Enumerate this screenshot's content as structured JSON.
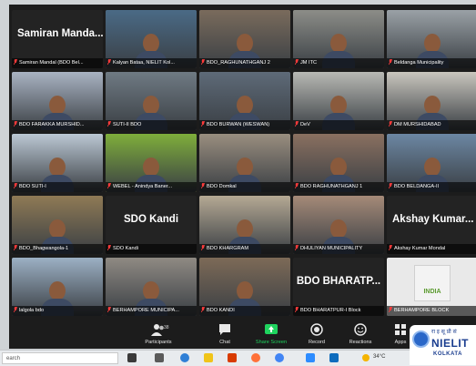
{
  "tiles": [
    {
      "big": "Samiran Manda...",
      "label": "Samiran Mandal (BDO Bel...",
      "scene": "dark",
      "active": false
    },
    {
      "big": "",
      "label": "Kalyan Bataa, NIELIT Kol...",
      "scene": "#4a6a86",
      "active": false
    },
    {
      "big": "",
      "label": "BDO_RAGHUNATHGANJ 2",
      "scene": "#7a6b5c",
      "active": false
    },
    {
      "big": "",
      "label": "JM ITC",
      "scene": "#8c8d88",
      "active": false
    },
    {
      "big": "",
      "label": "Beldanga Municipality",
      "scene": "#9aa1a6",
      "active": false
    },
    {
      "big": "",
      "label": "BDO FARAKKA MURSHID...",
      "scene": "#a9b3c2",
      "active": false
    },
    {
      "big": "",
      "label": "SUTI-II BDO",
      "scene": "#6f7a83",
      "active": false
    },
    {
      "big": "",
      "label": "BDO BURWAN (WESWAN)",
      "scene": "#5e6a78",
      "active": false
    },
    {
      "big": "",
      "label": "DeV",
      "scene": "#b8b9b4",
      "active": false
    },
    {
      "big": "",
      "label": "DM MURSHIDABAD",
      "scene": "#c9c6be",
      "active": false
    },
    {
      "big": "",
      "label": "BDO SUTI-I",
      "scene": "#bcc8d4",
      "active": false
    },
    {
      "big": "",
      "label": "WEBEL - Anindya Baner...",
      "scene": "#7fae3b",
      "active": true
    },
    {
      "big": "",
      "label": "BDO Domkal",
      "scene": "#9a8e7f",
      "active": false
    },
    {
      "big": "",
      "label": "BDO RAGHUNATHGANJ 1",
      "scene": "#8a7060",
      "active": false
    },
    {
      "big": "",
      "label": "BDO BELDANGA-II",
      "scene": "#6c87a3",
      "active": false
    },
    {
      "big": "",
      "label": "BDO_Bhagwangola-1",
      "scene": "#8f7a55",
      "active": false
    },
    {
      "big": "SDO Kandi",
      "label": "SDO Kandi",
      "scene": "dark",
      "active": false
    },
    {
      "big": "",
      "label": "BDO KHARGRAM",
      "scene": "#b5a994",
      "active": false
    },
    {
      "big": "",
      "label": "DHULIYAN MUNICIPALITY",
      "scene": "#a58a78",
      "active": false
    },
    {
      "big": "Akshay Kumar...",
      "label": "Akshay Kumar Mondal",
      "scene": "dark",
      "active": false
    },
    {
      "big": "",
      "label": "lalgola bdo",
      "scene": "#9cb0c4",
      "active": false
    },
    {
      "big": "",
      "label": "BERHAMPORE MUNICIPA...",
      "scene": "#8f8a83",
      "active": false
    },
    {
      "big": "",
      "label": "BDO KANDI",
      "scene": "#7d6a57",
      "active": false
    },
    {
      "big": "BDO BHARATP...",
      "label": "BDO BHARATPUR-I Block",
      "scene": "dark",
      "active": false
    },
    {
      "big": "",
      "label": "BERHAMPORE BLOCK",
      "scene": "logo",
      "logo_text": "INDIA",
      "active": false
    }
  ],
  "controls": {
    "participants": {
      "label": "Participants",
      "count": "38"
    },
    "chat": "Chat",
    "share": "Share Screen",
    "record": "Record",
    "reactions": "Reactions",
    "apps": "Apps"
  },
  "taskbar": {
    "search_placeholder": "earch",
    "weather": "34°C"
  },
  "watermark": {
    "hindi": "रा इ सू प्रौ सं",
    "name": "NIELIT",
    "city": "KOLKATA"
  },
  "colors": {
    "share_green": "#1fd35e",
    "active_outline": "#d7d93a",
    "nielit_blue": "#1a3d8f"
  }
}
